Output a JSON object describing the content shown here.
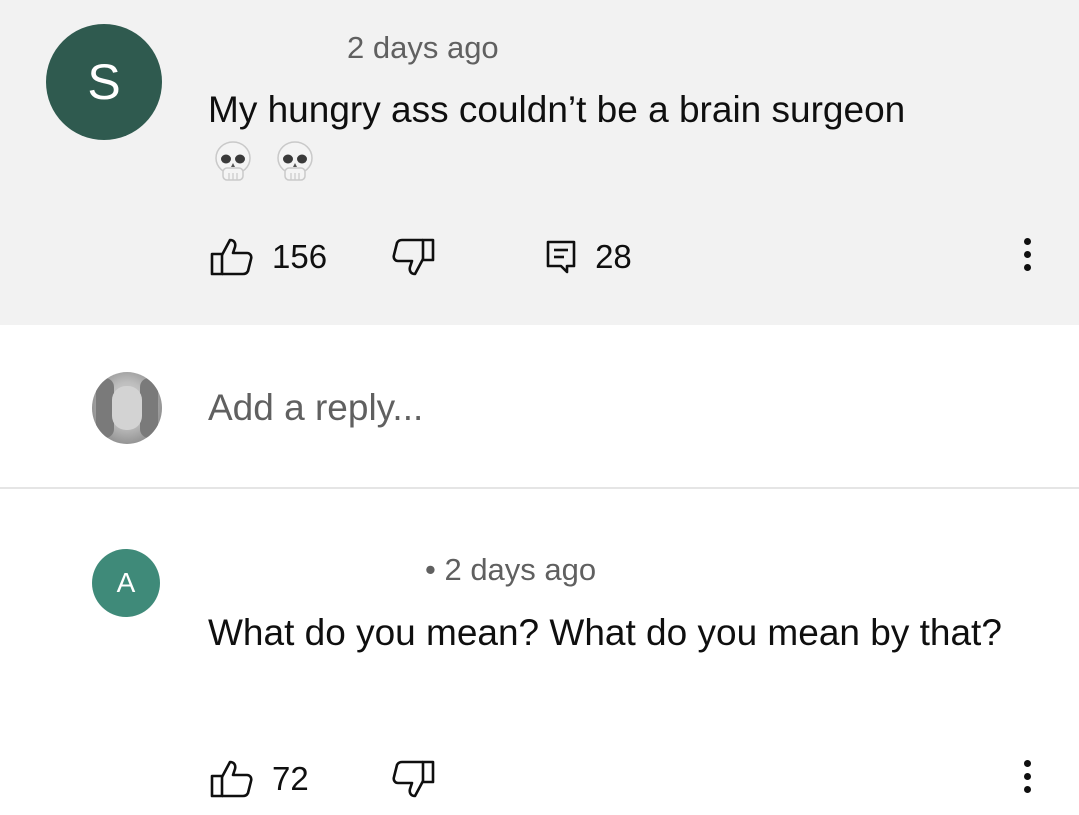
{
  "comment_1": {
    "avatar_letter": "S",
    "timestamp": "2 days ago",
    "text": "My hungry ass couldn’t be a brain surgeon",
    "emojis": [
      "skull-emoji",
      "skull-emoji"
    ],
    "like_count": "156",
    "reply_count": "28",
    "avatar_color": "#2f5a4f",
    "background": "#f2f2f2"
  },
  "reply_box": {
    "placeholder": "Add a reply..."
  },
  "comment_2": {
    "avatar_letter": "A",
    "timestamp": "• 2 days ago",
    "text": "What do you mean? What do you mean by that?",
    "like_count": "72",
    "avatar_color": "#3f8a79"
  },
  "icons": {
    "like": "thumbs-up-icon",
    "dislike": "thumbs-down-icon",
    "reply": "reply-icon",
    "more": "more-vertical-icon"
  }
}
